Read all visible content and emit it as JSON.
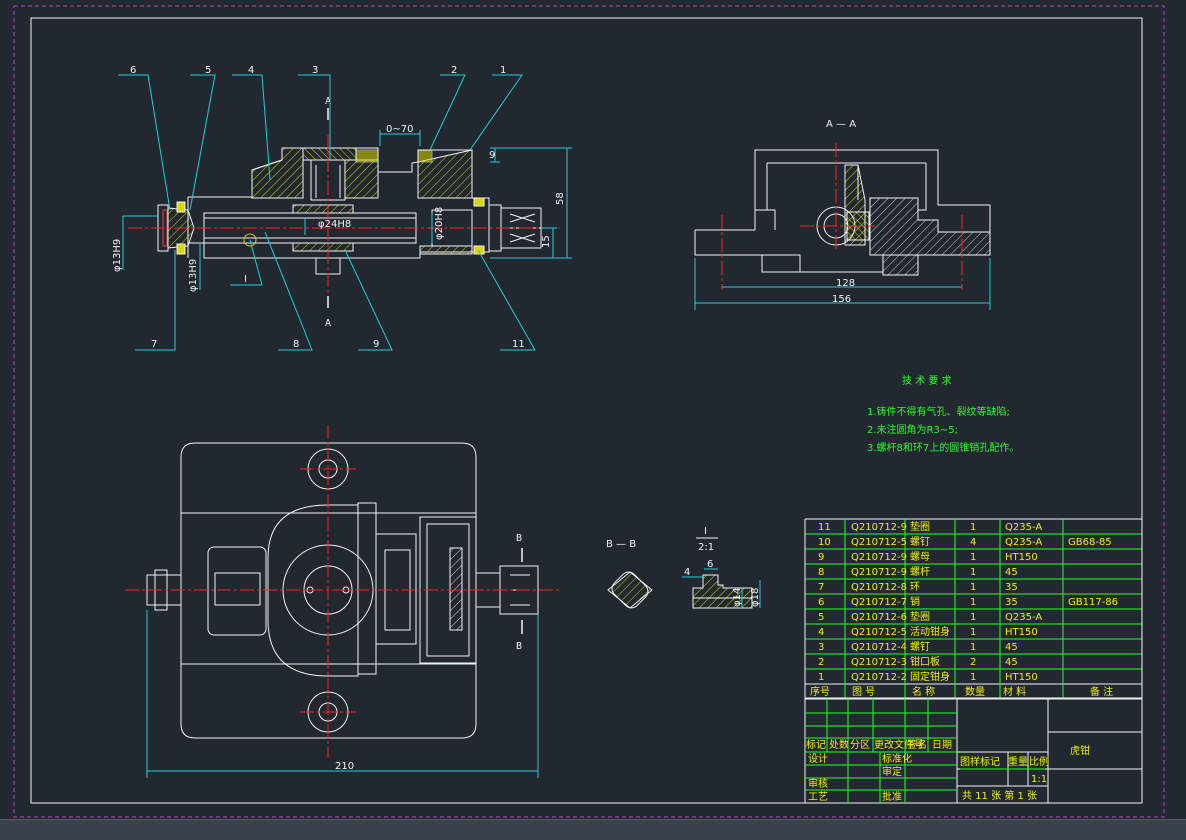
{
  "section_label_aa": "A",
  "section_title_aa": "A — A",
  "section_title_bb": "B — B",
  "section_label_b": "B",
  "detail_title": "I",
  "detail_scale": "2:1",
  "detail_mark": "I",
  "balloons": [
    "6",
    "5",
    "4",
    "3",
    "2",
    "1",
    "7",
    "8",
    "9",
    "11"
  ],
  "dims": {
    "d_070": "0~70",
    "d_9": "9",
    "d_58": "58",
    "d_15": "15",
    "d_24": "φ24H8",
    "d_20": "φ20H8",
    "d_13a": "φ13H9",
    "d_13b": "φ13H9",
    "d_128": "128",
    "d_156": "156",
    "d_210": "210",
    "d_4": "4",
    "d_6": "6",
    "d_14": "φ14",
    "d_18": "φ18"
  },
  "tech_req": {
    "title": "技 术 要 求",
    "items": [
      "1.铸件不得有气孔、裂纹等缺陷;",
      "2.未注圆角为R3~5;",
      "3.螺杆8和环7上的圆锥销孔配作。"
    ]
  },
  "parts_table": {
    "rows": [
      [
        "11",
        "Q210712-9",
        "垫圈",
        "1",
        "Q235-A",
        ""
      ],
      [
        "10",
        "Q210712-5",
        "螺钉",
        "4",
        "Q235-A",
        "GB68-85"
      ],
      [
        "9",
        "Q210712-9",
        "螺母",
        "1",
        "HT150",
        ""
      ],
      [
        "8",
        "Q210712-9",
        "螺杆",
        "1",
        "45",
        ""
      ],
      [
        "7",
        "Q210712-8",
        "环",
        "1",
        "35",
        ""
      ],
      [
        "6",
        "Q210712-7",
        "销",
        "1",
        "35",
        "GB117-86"
      ],
      [
        "5",
        "Q210712-6",
        "垫圈",
        "1",
        "Q235-A",
        ""
      ],
      [
        "4",
        "Q210712-5",
        "活动钳身",
        "1",
        "HT150",
        ""
      ],
      [
        "3",
        "Q210712-4",
        "螺钉",
        "1",
        "45",
        ""
      ],
      [
        "2",
        "Q210712-3",
        "钳口板",
        "2",
        "45",
        ""
      ],
      [
        "1",
        "Q210712-2",
        "固定钳身",
        "1",
        "HT150",
        ""
      ]
    ],
    "header": [
      "序号",
      "图 号",
      "名 称",
      "数量",
      "材 料",
      "备 注"
    ]
  },
  "title_block": {
    "name": "虎钳",
    "rev_cols": [
      "标记",
      "处数",
      "分区",
      "更改文件号",
      "签名",
      "日期"
    ],
    "row_design": "设计",
    "row_std": "标准化",
    "row_check": "审核",
    "row_process": "工艺",
    "row_approve": "批准",
    "row_audit": "审定",
    "stage_mark": "图样标记",
    "weight": "重量",
    "scale_lbl": "比例",
    "scale": "1:1",
    "sheets": "共 11 张  第 1 张"
  },
  "colors": {
    "background": "#212830",
    "frame": "#c040c0",
    "outline": "#f2f2f2",
    "hatch": "#d8d800",
    "centerline": "#ff2020",
    "dimension": "#22ccdd",
    "text_green": "#22ff22",
    "table_text": "#f0f000"
  }
}
